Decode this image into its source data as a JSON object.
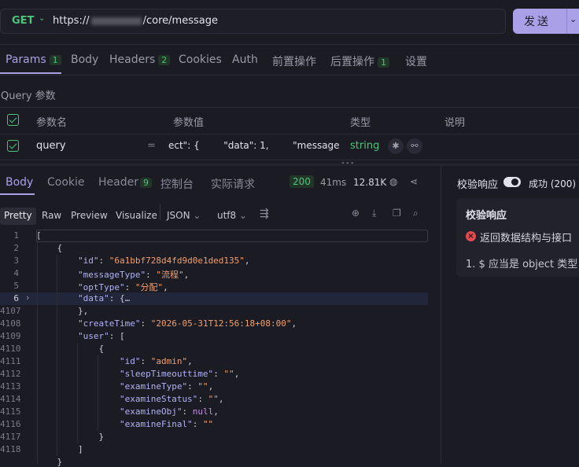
{
  "request": {
    "method": "GET",
    "url_prefix": "https://",
    "url_suffix": "/core/message",
    "send_label": "发送"
  },
  "req_tabs": [
    {
      "label": "Params",
      "count": "1"
    },
    {
      "label": "Body"
    },
    {
      "label": "Headers",
      "count": "2"
    },
    {
      "label": "Cookies"
    },
    {
      "label": "Auth"
    },
    {
      "label": "前置操作"
    },
    {
      "label": "后置操作",
      "count": "1"
    },
    {
      "label": "设置"
    }
  ],
  "query": {
    "title": "Query 参数",
    "headers": {
      "name": "参数名",
      "value": "参数值",
      "type": "类型",
      "desc": "说明"
    },
    "row": {
      "name": "query",
      "eq": "=",
      "value": "ect\": {        \"data\": 1,        \"message'",
      "type": "string"
    }
  },
  "resp_tabs": [
    {
      "label": "Body"
    },
    {
      "label": "Cookie"
    },
    {
      "label": "Header",
      "count": "9"
    },
    {
      "label": "控制台"
    },
    {
      "label": "实际请求"
    }
  ],
  "resp_meta": {
    "status": "200",
    "time": "41ms",
    "size": "12.81K"
  },
  "view_tabs": [
    "Pretty",
    "Raw",
    "Preview",
    "Visualize"
  ],
  "format": {
    "lang": "JSON",
    "encoding": "utf8"
  },
  "code": {
    "line_numbers": [
      "1",
      "2",
      "3",
      "4",
      "5",
      "6",
      "4107",
      "4108",
      "4109",
      "4110",
      "4111",
      "4112",
      "4113",
      "4114",
      "4115",
      "4116",
      "4117",
      "4118"
    ],
    "lines": [
      "[",
      "    {",
      "        \"id\": \"6a1bbf728d4fd9d0e1ded135\",",
      "        \"messageType\": \"流程\",",
      "        \"optType\": \"分配\",",
      "        \"data\": {…",
      "        },",
      "        \"createTime\": \"2026-05-31T12:56:18+08:00\",",
      "        \"user\": [",
      "            {",
      "                \"id\": \"admin\",",
      "                \"sleepTimeouttime\": \"\",",
      "                \"examineType\": \"\",",
      "                \"examineStatus\": \"\",",
      "                \"examineObj\": null,",
      "                \"examineFinal\": \"\"",
      "            }",
      "        ]",
      "    }"
    ]
  },
  "validation": {
    "title": "校验响应",
    "status": "成功 (200)",
    "card_title": "校验响应",
    "error": "返回数据结构与接口",
    "detail": "1. $ 应当是 object 类型"
  },
  "colors": {
    "accent": "#a9a0e8",
    "success": "#4cc47a",
    "error": "#e5484d",
    "background": "#1b1b24"
  }
}
